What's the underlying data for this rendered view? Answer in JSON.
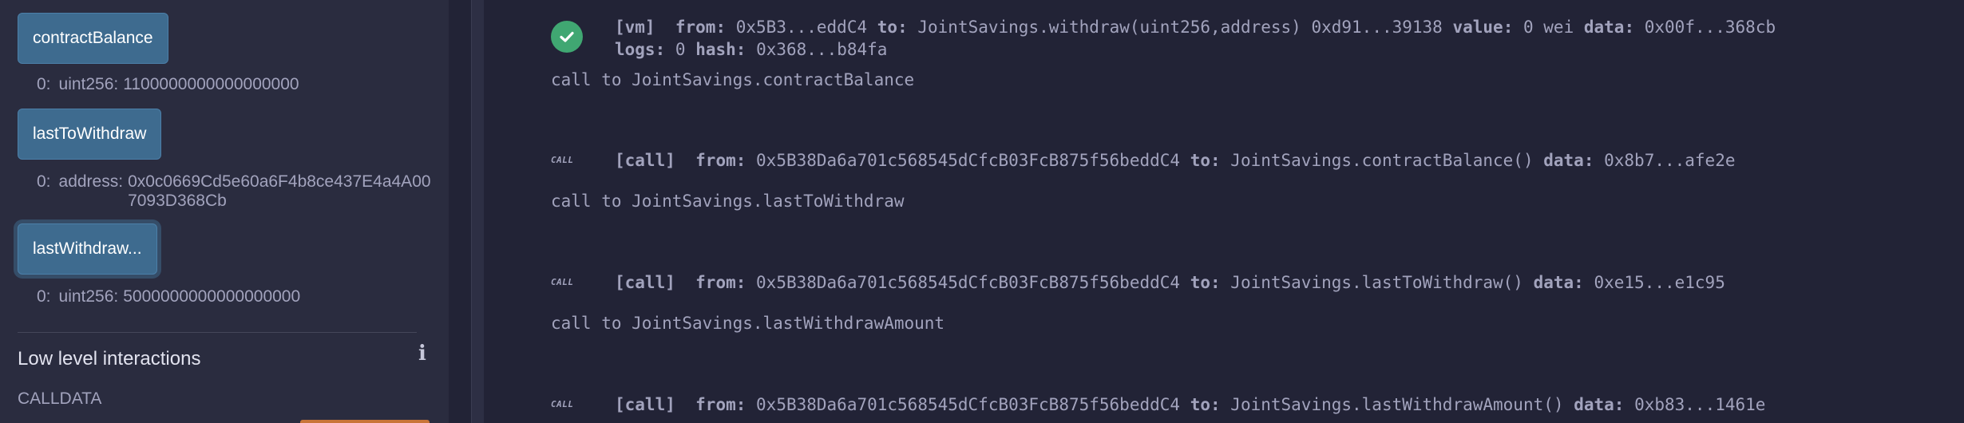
{
  "left_panel": {
    "functions": [
      {
        "label": "contractBalance",
        "ret_index": "0:",
        "ret_type": "uint256:",
        "ret_value": "1100000000000000000"
      },
      {
        "label": "lastToWithdraw",
        "ret_index": "0:",
        "ret_type": "address:",
        "ret_value": "0x0c0669Cd5e60a6F4b8ce437E4a4A007093D368Cb"
      },
      {
        "label": "lastWithdraw...",
        "ret_index": "0:",
        "ret_type": "uint256:",
        "ret_value": "5000000000000000000"
      }
    ],
    "low_level_title": "Low level interactions",
    "info_icon": "i",
    "calldata_label": "CALLDATA"
  },
  "terminal": {
    "tx": {
      "tag": "[vm]",
      "from_label": "from:",
      "from": "0x5B3...eddC4",
      "to_label": "to:",
      "to": "JointSavings.withdraw(uint256,address) 0xd91...39138",
      "value_label": "value:",
      "value": "0 wei",
      "data_label": "data:",
      "data": "0x00f...368cb",
      "logs_label": "logs:",
      "logs": "0",
      "hash_label": "hash:",
      "hash": "0x368...b84fa"
    },
    "calls": [
      {
        "heading": "call to JointSavings.contractBalance",
        "badge": "CALL",
        "tag": "[call]",
        "from_label": "from:",
        "from": "0x5B38Da6a701c568545dCfcB03FcB875f56beddC4",
        "to_label": "to:",
        "to": "JointSavings.contractBalance()",
        "data_label": "data:",
        "data": "0x8b7...afe2e"
      },
      {
        "heading": "call to JointSavings.lastToWithdraw",
        "badge": "CALL",
        "tag": "[call]",
        "from_label": "from:",
        "from": "0x5B38Da6a701c568545dCfcB03FcB875f56beddC4",
        "to_label": "to:",
        "to": "JointSavings.lastToWithdraw()",
        "data_label": "data:",
        "data": "0xe15...e1c95"
      },
      {
        "heading": "call to JointSavings.lastWithdrawAmount",
        "badge": "CALL",
        "tag": "[call]",
        "from_label": "from:",
        "from": "0x5B38Da6a701c568545dCfcB03FcB875f56beddC4",
        "to_label": "to:",
        "to": "JointSavings.lastWithdrawAmount()",
        "data_label": "data:",
        "data": "0xb83...1461e"
      }
    ]
  },
  "colors": {
    "panel_bg": "#2a2c3f",
    "terminal_bg": "#222336",
    "button_bg": "#3e6b8f",
    "success": "#40a772",
    "text": "#a2a3bd"
  },
  "icons": {
    "status": "check-circle-icon",
    "info": "info-icon"
  }
}
